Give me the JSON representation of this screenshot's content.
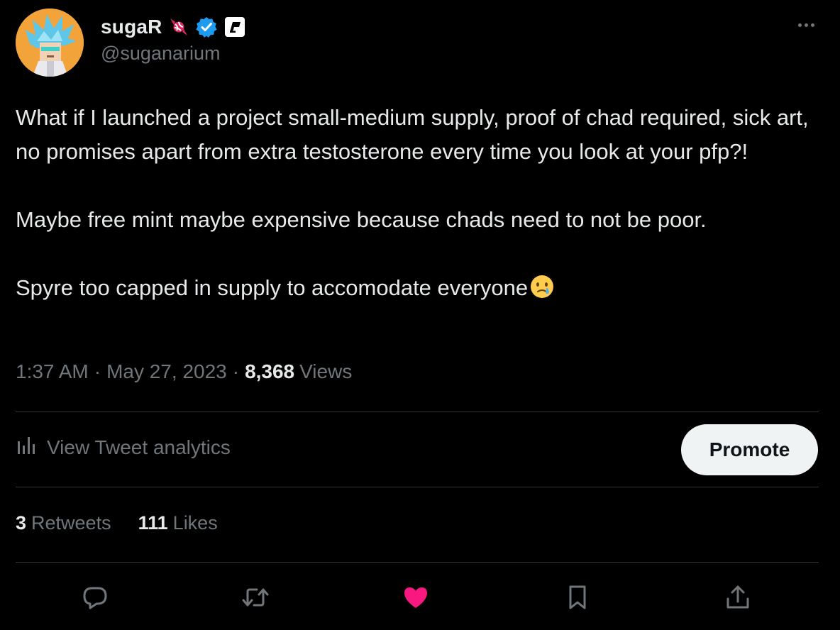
{
  "author": {
    "display_name": "sugaR",
    "handle": "@suganarium"
  },
  "tweet": {
    "paragraphs": [
      "What if I launched a project small-medium supply, proof of chad required, sick art, no promises apart from extra testosterone every time you look at your pfp?!",
      "Maybe free mint maybe expensive because chads need to not be poor.",
      "Spyre too capped in supply to accomodate everyone"
    ]
  },
  "meta": {
    "time": "1:37 AM",
    "separator": "·",
    "date": "May 27, 2023",
    "views_count": "8,368",
    "views_label": "Views"
  },
  "analytics": {
    "label": "View Tweet analytics",
    "promote_label": "Promote"
  },
  "stats": {
    "retweets_count": "3",
    "retweets_label": "Retweets",
    "likes_count": "111",
    "likes_label": "Likes"
  },
  "actions": {
    "reply_icon": "reply-icon",
    "retweet_icon": "retweet-icon",
    "like_icon": "heart-icon",
    "bookmark_icon": "bookmark-icon",
    "share_icon": "share-icon",
    "liked": true
  },
  "colors": {
    "background": "#000000",
    "text_primary": "#e7e9ea",
    "text_secondary": "#71767b",
    "divider": "#2f3336",
    "verified_blue": "#1d9bf0",
    "like_pink": "#f91880",
    "promote_bg": "#eff3f4"
  }
}
